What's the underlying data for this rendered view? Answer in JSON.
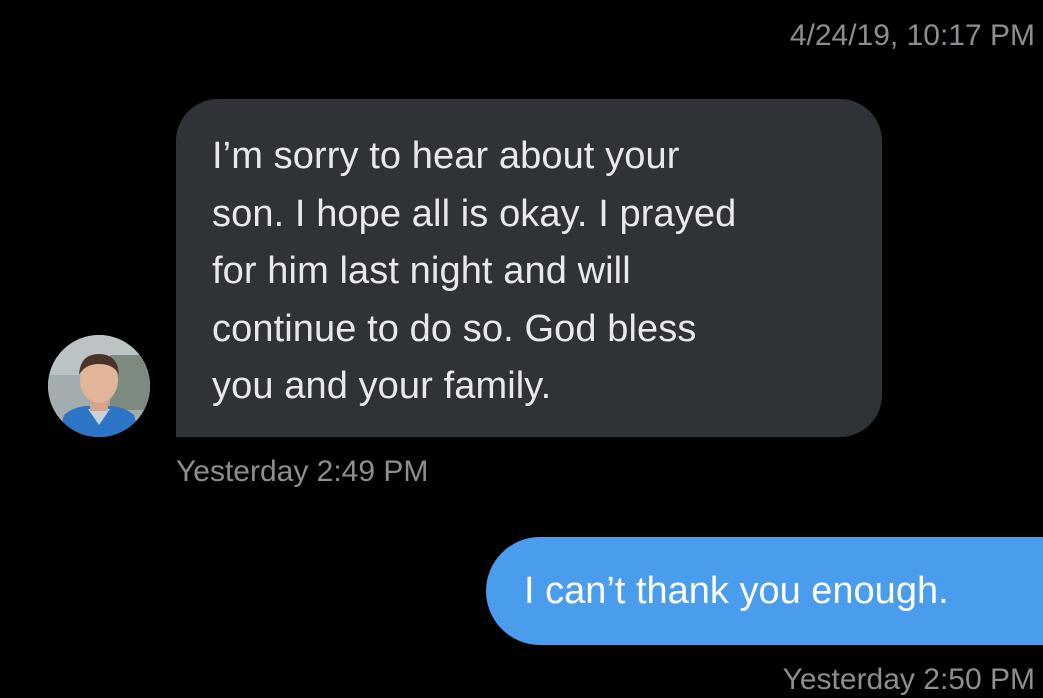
{
  "conversation": {
    "top_timestamp": "4/24/19, 10:17 PM",
    "messages": [
      {
        "direction": "received",
        "lines": [
          "I’m sorry to hear about your",
          "son. I hope all is okay. I prayed",
          "for him last night and will",
          "continue to do so. God bless",
          "you and your family."
        ],
        "timestamp": "Yesterday 2:49 PM"
      },
      {
        "direction": "sent",
        "text": "I can’t thank you enough.",
        "timestamp": "Yesterday 2:50 PM"
      }
    ]
  },
  "colors": {
    "background": "#000000",
    "received_bubble": "#2f3237",
    "sent_bubble": "#4a9ded",
    "timestamp_text": "#8b8f94"
  },
  "icons": {
    "sender_avatar": "avatar-photo"
  }
}
